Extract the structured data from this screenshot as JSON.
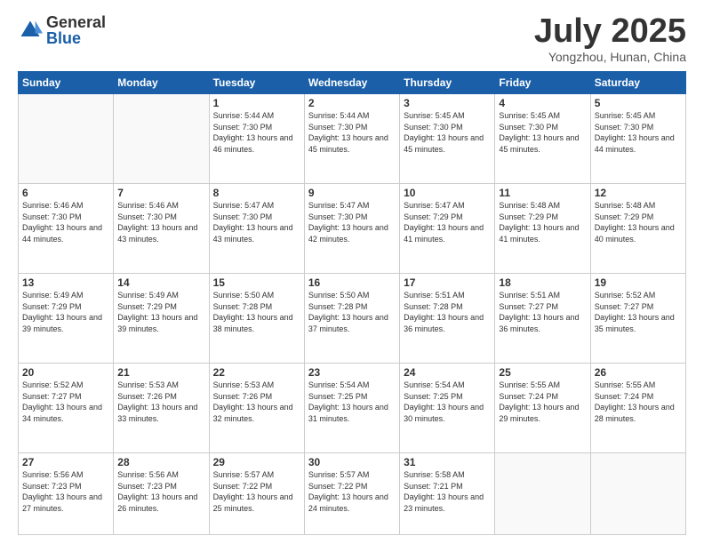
{
  "logo": {
    "general": "General",
    "blue": "Blue"
  },
  "title": {
    "month_year": "July 2025",
    "location": "Yongzhou, Hunan, China"
  },
  "days_of_week": [
    "Sunday",
    "Monday",
    "Tuesday",
    "Wednesday",
    "Thursday",
    "Friday",
    "Saturday"
  ],
  "weeks": [
    [
      {
        "day": "",
        "info": ""
      },
      {
        "day": "",
        "info": ""
      },
      {
        "day": "1",
        "info": "Sunrise: 5:44 AM\nSunset: 7:30 PM\nDaylight: 13 hours and 46 minutes."
      },
      {
        "day": "2",
        "info": "Sunrise: 5:44 AM\nSunset: 7:30 PM\nDaylight: 13 hours and 45 minutes."
      },
      {
        "day": "3",
        "info": "Sunrise: 5:45 AM\nSunset: 7:30 PM\nDaylight: 13 hours and 45 minutes."
      },
      {
        "day": "4",
        "info": "Sunrise: 5:45 AM\nSunset: 7:30 PM\nDaylight: 13 hours and 45 minutes."
      },
      {
        "day": "5",
        "info": "Sunrise: 5:45 AM\nSunset: 7:30 PM\nDaylight: 13 hours and 44 minutes."
      }
    ],
    [
      {
        "day": "6",
        "info": "Sunrise: 5:46 AM\nSunset: 7:30 PM\nDaylight: 13 hours and 44 minutes."
      },
      {
        "day": "7",
        "info": "Sunrise: 5:46 AM\nSunset: 7:30 PM\nDaylight: 13 hours and 43 minutes."
      },
      {
        "day": "8",
        "info": "Sunrise: 5:47 AM\nSunset: 7:30 PM\nDaylight: 13 hours and 43 minutes."
      },
      {
        "day": "9",
        "info": "Sunrise: 5:47 AM\nSunset: 7:30 PM\nDaylight: 13 hours and 42 minutes."
      },
      {
        "day": "10",
        "info": "Sunrise: 5:47 AM\nSunset: 7:29 PM\nDaylight: 13 hours and 41 minutes."
      },
      {
        "day": "11",
        "info": "Sunrise: 5:48 AM\nSunset: 7:29 PM\nDaylight: 13 hours and 41 minutes."
      },
      {
        "day": "12",
        "info": "Sunrise: 5:48 AM\nSunset: 7:29 PM\nDaylight: 13 hours and 40 minutes."
      }
    ],
    [
      {
        "day": "13",
        "info": "Sunrise: 5:49 AM\nSunset: 7:29 PM\nDaylight: 13 hours and 39 minutes."
      },
      {
        "day": "14",
        "info": "Sunrise: 5:49 AM\nSunset: 7:29 PM\nDaylight: 13 hours and 39 minutes."
      },
      {
        "day": "15",
        "info": "Sunrise: 5:50 AM\nSunset: 7:28 PM\nDaylight: 13 hours and 38 minutes."
      },
      {
        "day": "16",
        "info": "Sunrise: 5:50 AM\nSunset: 7:28 PM\nDaylight: 13 hours and 37 minutes."
      },
      {
        "day": "17",
        "info": "Sunrise: 5:51 AM\nSunset: 7:28 PM\nDaylight: 13 hours and 36 minutes."
      },
      {
        "day": "18",
        "info": "Sunrise: 5:51 AM\nSunset: 7:27 PM\nDaylight: 13 hours and 36 minutes."
      },
      {
        "day": "19",
        "info": "Sunrise: 5:52 AM\nSunset: 7:27 PM\nDaylight: 13 hours and 35 minutes."
      }
    ],
    [
      {
        "day": "20",
        "info": "Sunrise: 5:52 AM\nSunset: 7:27 PM\nDaylight: 13 hours and 34 minutes."
      },
      {
        "day": "21",
        "info": "Sunrise: 5:53 AM\nSunset: 7:26 PM\nDaylight: 13 hours and 33 minutes."
      },
      {
        "day": "22",
        "info": "Sunrise: 5:53 AM\nSunset: 7:26 PM\nDaylight: 13 hours and 32 minutes."
      },
      {
        "day": "23",
        "info": "Sunrise: 5:54 AM\nSunset: 7:25 PM\nDaylight: 13 hours and 31 minutes."
      },
      {
        "day": "24",
        "info": "Sunrise: 5:54 AM\nSunset: 7:25 PM\nDaylight: 13 hours and 30 minutes."
      },
      {
        "day": "25",
        "info": "Sunrise: 5:55 AM\nSunset: 7:24 PM\nDaylight: 13 hours and 29 minutes."
      },
      {
        "day": "26",
        "info": "Sunrise: 5:55 AM\nSunset: 7:24 PM\nDaylight: 13 hours and 28 minutes."
      }
    ],
    [
      {
        "day": "27",
        "info": "Sunrise: 5:56 AM\nSunset: 7:23 PM\nDaylight: 13 hours and 27 minutes."
      },
      {
        "day": "28",
        "info": "Sunrise: 5:56 AM\nSunset: 7:23 PM\nDaylight: 13 hours and 26 minutes."
      },
      {
        "day": "29",
        "info": "Sunrise: 5:57 AM\nSunset: 7:22 PM\nDaylight: 13 hours and 25 minutes."
      },
      {
        "day": "30",
        "info": "Sunrise: 5:57 AM\nSunset: 7:22 PM\nDaylight: 13 hours and 24 minutes."
      },
      {
        "day": "31",
        "info": "Sunrise: 5:58 AM\nSunset: 7:21 PM\nDaylight: 13 hours and 23 minutes."
      },
      {
        "day": "",
        "info": ""
      },
      {
        "day": "",
        "info": ""
      }
    ]
  ]
}
